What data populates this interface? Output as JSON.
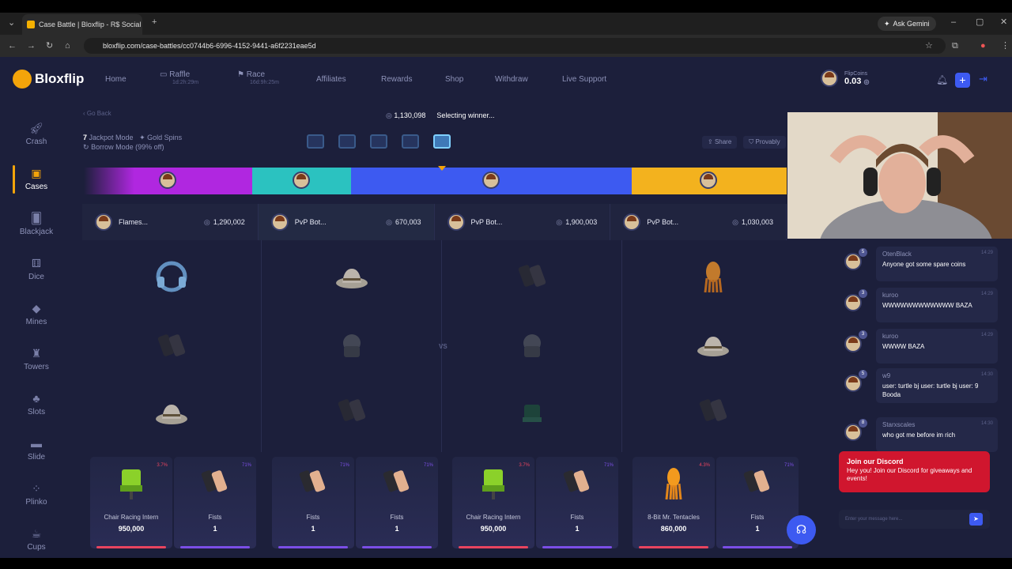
{
  "browser": {
    "tab_title": "Case Battle | Bloxflip - R$ Social",
    "url": "bloxflip.com/case-battles/cc0744b6-6996-4152-9441-a6f2231eae5d",
    "gemini_label": "Ask Gemini"
  },
  "brand": {
    "logo": "Bloxflip",
    "accent": "#f3a40a",
    "primary": "#3d5af1"
  },
  "nav": {
    "home": "Home",
    "raffle": "Raffle",
    "raffle_timer": "1d:2h:29m",
    "race": "Race",
    "race_timer": "16d:9h:25m",
    "affiliates": "Affiliates",
    "rewards": "Rewards",
    "shop": "Shop",
    "withdraw": "Withdraw",
    "live_support": "Live Support"
  },
  "wallet": {
    "label": "FlipCoins",
    "amount": "0.03"
  },
  "sidebar": {
    "items": [
      {
        "label": "Crash",
        "icon": "rocket-icon"
      },
      {
        "label": "Cases",
        "icon": "case-icon"
      },
      {
        "label": "Blackjack",
        "icon": "cards-icon"
      },
      {
        "label": "Dice",
        "icon": "dice-icon"
      },
      {
        "label": "Mines",
        "icon": "diamond-icon"
      },
      {
        "label": "Towers",
        "icon": "tower-icon"
      },
      {
        "label": "Slots",
        "icon": "slots-icon"
      },
      {
        "label": "Slide",
        "icon": "slide-icon"
      },
      {
        "label": "Plinko",
        "icon": "plinko-icon"
      },
      {
        "label": "Cups",
        "icon": "cup-icon"
      }
    ]
  },
  "battle": {
    "go_back": "Go Back",
    "pot": "1,130,098",
    "status": "Selecting winner...",
    "jackpot_mode": "Jackpot Mode",
    "gold_spins": "Gold Spins",
    "borrow_mode": "Borrow Mode (99% off)",
    "share": "Share",
    "provably": "Provably",
    "vs": "VS",
    "segment_colors": [
      "#b027e0",
      "#2bc2c0",
      "#3d5af1",
      "#f3b21e"
    ],
    "jackpot_share": [
      0.24,
      0.14,
      0.4,
      0.22
    ],
    "players": [
      {
        "name": "Flames...",
        "score": "1,290,002"
      },
      {
        "name": "PvP Bot...",
        "score": "670,003"
      },
      {
        "name": "PvP Bot...",
        "score": "1,900,003"
      },
      {
        "name": "PvP Bot...",
        "score": "1,030,003"
      }
    ]
  },
  "drops": [
    {
      "name": "Chair Racing Intern",
      "price": "950,000",
      "pct": "3.7%",
      "color": "#e8445f"
    },
    {
      "name": "Fists",
      "price": "1",
      "pct": "71%",
      "color": "#7b4ee6"
    },
    {
      "name": "Fists",
      "price": "1",
      "pct": "71%",
      "color": "#7b4ee6"
    },
    {
      "name": "Fists",
      "price": "1",
      "pct": "71%",
      "color": "#7b4ee6"
    },
    {
      "name": "Chair Racing Intern",
      "price": "950,000",
      "pct": "3.7%",
      "color": "#e8445f"
    },
    {
      "name": "Fists",
      "price": "1",
      "pct": "71%",
      "color": "#7b4ee6"
    },
    {
      "name": "8-Bit Mr. Tentacles",
      "price": "860,000",
      "pct": "4.3%",
      "color": "#e8445f"
    },
    {
      "name": "Fists",
      "price": "1",
      "pct": "71%",
      "color": "#7b4ee6"
    }
  ],
  "chat": {
    "messages": [
      {
        "user": "OtenBlack",
        "time": "14:29",
        "text": "Anyone got some spare coins",
        "level": "5"
      },
      {
        "user": "kuroo",
        "time": "14:29",
        "text": "WWWWWWWWWWWW BAZA",
        "level": "3"
      },
      {
        "user": "kuroo",
        "time": "14:29",
        "text": "WWWW BAZA",
        "level": "3"
      },
      {
        "user": "w9",
        "time": "14:30",
        "text": "user: turtle bj user: turtle bj user: 9 Booda",
        "level": "5"
      },
      {
        "user": "Starxscales",
        "time": "14:30",
        "text": "who got me before im rich",
        "level": "8"
      }
    ],
    "discord_title": "Join our Discord",
    "discord_text": "Hey you! Join our Discord for giveaways and events!",
    "input_placeholder": "Enter your message here..."
  }
}
